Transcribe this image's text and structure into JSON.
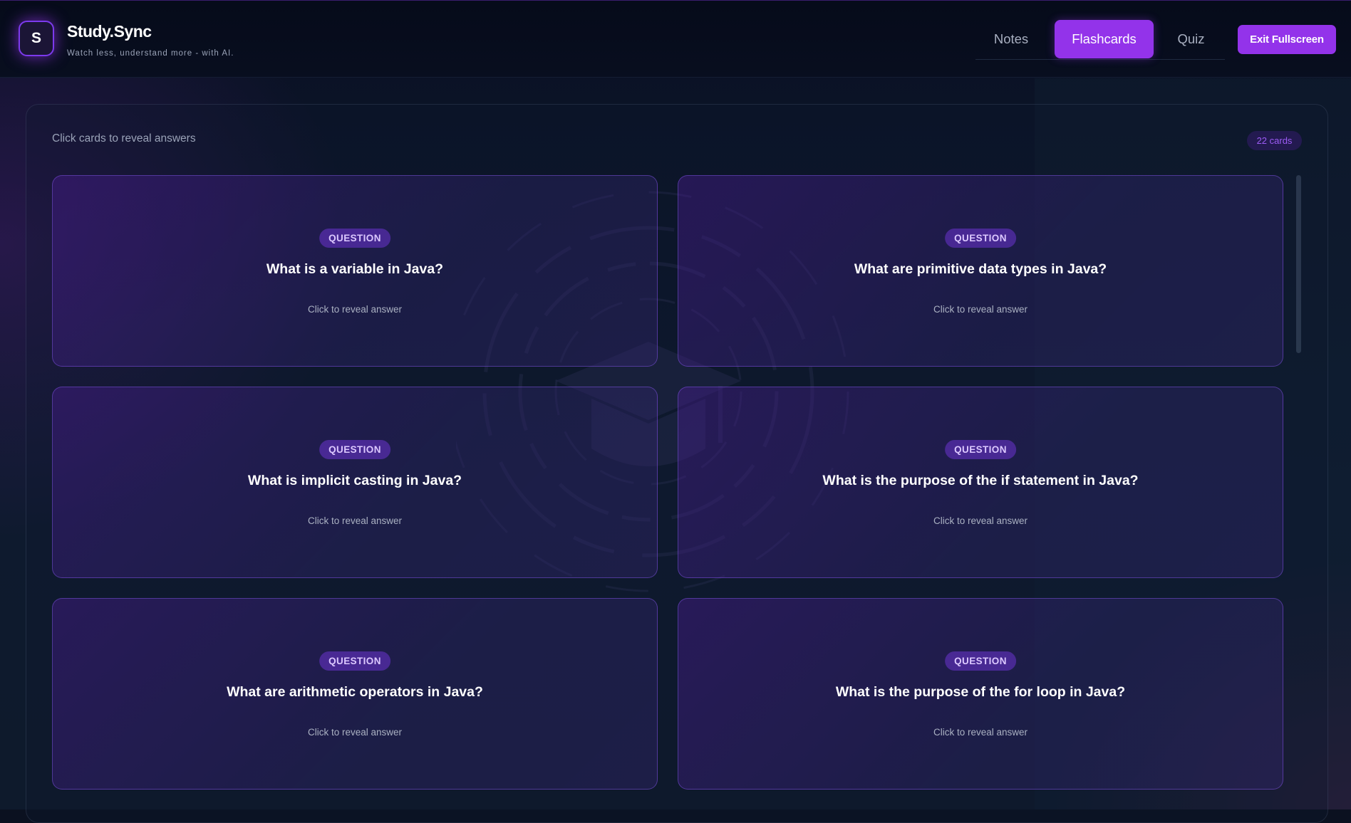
{
  "brand": {
    "logo_letter": "S",
    "title": "Study.Sync",
    "subtitle": "Watch less, understand more - with AI."
  },
  "tabs": [
    {
      "label": "Notes",
      "active": false
    },
    {
      "label": "Flashcards",
      "active": true
    },
    {
      "label": "Quiz",
      "active": false
    }
  ],
  "header": {
    "exit_label": "Exit Fullscreen"
  },
  "flashcards": {
    "hint": "Click cards to reveal answers",
    "count_label": "22 cards",
    "cards": [
      {
        "badge": "QUESTION",
        "question": "What is a variable in Java?",
        "reveal": "Click to reveal answer"
      },
      {
        "badge": "QUESTION",
        "question": "What are primitive data types in Java?",
        "reveal": "Click to reveal answer"
      },
      {
        "badge": "QUESTION",
        "question": "What is implicit casting in Java?",
        "reveal": "Click to reveal answer"
      },
      {
        "badge": "QUESTION",
        "question": "What is the purpose of the if statement in Java?",
        "reveal": "Click to reveal answer"
      },
      {
        "badge": "QUESTION",
        "question": "What are arithmetic operators in Java?",
        "reveal": "Click to reveal answer"
      },
      {
        "badge": "QUESTION",
        "question": "What is the purpose of the for loop in Java?",
        "reveal": "Click to reveal answer"
      }
    ]
  },
  "colors": {
    "accent": "#9333ea",
    "background": "#0b1120",
    "card_border": "#8b5cf6"
  },
  "icons": {
    "background_decoration": "graduation-cap-icon"
  }
}
